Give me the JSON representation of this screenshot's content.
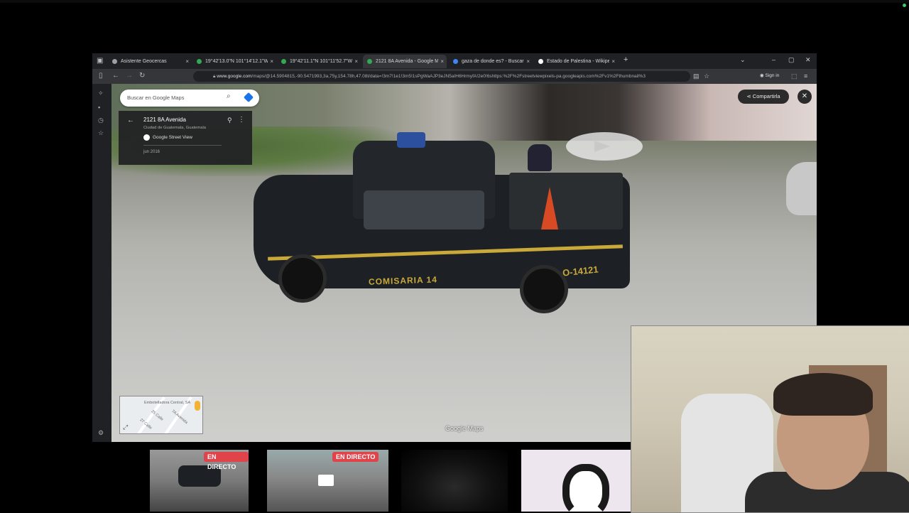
{
  "browser": {
    "tabs": [
      {
        "title": "Asistente Geocercas",
        "active": false,
        "favicon_color": "#9aa0a6"
      },
      {
        "title": "19°42'13.0\"N 101°14'12.1\"W - G",
        "active": false,
        "favicon_color": "#34a853"
      },
      {
        "title": "19°42'11.1\"N 101°11'52.7\"W - G",
        "active": false,
        "favicon_color": "#34a853"
      },
      {
        "title": "2121 8A Avenida - Google Map",
        "active": true,
        "favicon_color": "#34a853"
      },
      {
        "title": "gaza de donde es? - Buscar con",
        "active": false,
        "favicon_color": "#4285f4"
      },
      {
        "title": "Estado de Palestina - Wikipedia",
        "active": false,
        "favicon_color": "#ffffff"
      }
    ],
    "tab_close": "×",
    "new_tab": "+",
    "url_host": "www.google.com",
    "url_rest": "/maps/@14.5904815,-90.5471993,3a,75y,154.78h,47.08t/data=!3m7!1e1!3m5!1sPgWaAJP3eJN5aIH6HrmyfA!2e0!6shttps:%2F%2Fstreetviewpixels-pa.googleapis.com%2Fv1%2Fthumbnail%3",
    "sign_in": "Sign in"
  },
  "maps": {
    "search_placeholder": "Buscar en Google Maps",
    "place_title": "2121 8A Avenida",
    "place_subtitle": "Ciudad de Guatemala, Guatemala",
    "source": "Google Street View",
    "date": "jun 2016",
    "share_label": "Compartirla",
    "watermark": "Google Maps",
    "minimap_labels": [
      "Embotelladora Central, SA",
      "25 Calle",
      "7A Avenida",
      "27 Calle"
    ]
  },
  "scene": {
    "vehicle_text": "COMISARIA 14",
    "plate": "O-14121"
  },
  "thumbnails": {
    "live_label": "EN DIRECTO"
  },
  "colors": {
    "accent_blue": "#1a73e8",
    "live_red": "#e0434a",
    "police_gold": "#c8a93a"
  }
}
